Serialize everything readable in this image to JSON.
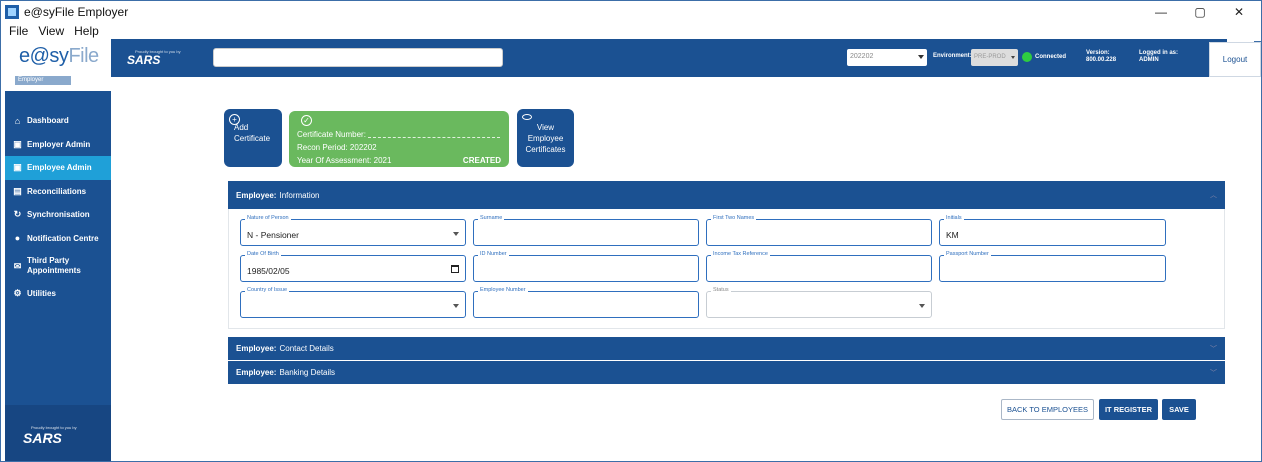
{
  "window": {
    "title": "e@syFile Employer",
    "controls": {
      "minimize": "—",
      "maximize": "▢",
      "close": "✕"
    }
  },
  "menubar": [
    "File",
    "View",
    "Help"
  ],
  "logo": {
    "brand_a": "e@sy",
    "brand_b": "File",
    "sub": "Employer"
  },
  "header": {
    "sars_tag": "Proudly brought to you by",
    "sars_brand": "SARS",
    "period_value": "202202",
    "environment_label": "Environment:",
    "environment_value": "PRE-PROD",
    "connected": "Connected",
    "version_label": "Version:",
    "version_value": "800.00.228",
    "login_label": "Logged in as:",
    "login_value": "ADMIN",
    "logout": "Logout"
  },
  "sidebar": {
    "items": [
      {
        "label": "Dashboard",
        "icon": "home-icon"
      },
      {
        "label": "Employer Admin",
        "icon": "id-card-icon"
      },
      {
        "label": "Employee Admin",
        "icon": "id-card-icon",
        "active": true
      },
      {
        "label": "Reconciliations",
        "icon": "document-icon"
      },
      {
        "label": "Synchronisation",
        "icon": "sync-icon"
      },
      {
        "label": "Notification Centre",
        "icon": "bell-icon"
      },
      {
        "label": "Third Party Appointments",
        "icon": "envelope-icon"
      },
      {
        "label": "Utilities",
        "icon": "gears-icon"
      }
    ],
    "footer_tag": "Proudly brought to you by",
    "footer_brand": "SARS"
  },
  "cards": {
    "add": "Add Certificate",
    "view": "View Employee Certificates",
    "cert": {
      "number_label": "Certificate Number:",
      "recon_period": "Recon Period: 202202",
      "year": "Year Of Assessment: 2021",
      "status": "CREATED"
    }
  },
  "panels": {
    "prefix": "Employee:",
    "information": "Information",
    "contact": "Contact Details",
    "banking": "Banking Details"
  },
  "fields": {
    "nature_of_person": {
      "label": "Nature of Person",
      "value": "N - Pensioner"
    },
    "surname": {
      "label": "Surname",
      "value": ""
    },
    "first_two_names": {
      "label": "First Two Names",
      "value": ""
    },
    "initials": {
      "label": "Initials",
      "value": "KM"
    },
    "date_of_birth": {
      "label": "Date Of Birth",
      "value": "1985/02/05"
    },
    "id_number": {
      "label": "ID Number",
      "value": ""
    },
    "income_tax_reference": {
      "label": "Income Tax Reference",
      "value": ""
    },
    "passport_number": {
      "label": "Passport Number",
      "value": ""
    },
    "country_of_issue": {
      "label": "Country of Issue",
      "value": ""
    },
    "employee_number": {
      "label": "Employee Number",
      "value": ""
    },
    "status": {
      "label": "Status",
      "value": ""
    }
  },
  "buttons": {
    "back": "BACK TO EMPLOYEES",
    "it_register": "IT REGISTER",
    "save": "SAVE"
  },
  "colors": {
    "navy": "#1b5192",
    "active": "#1fa0d8",
    "green_card": "#6ab95e",
    "connected": "#2ecc40"
  }
}
